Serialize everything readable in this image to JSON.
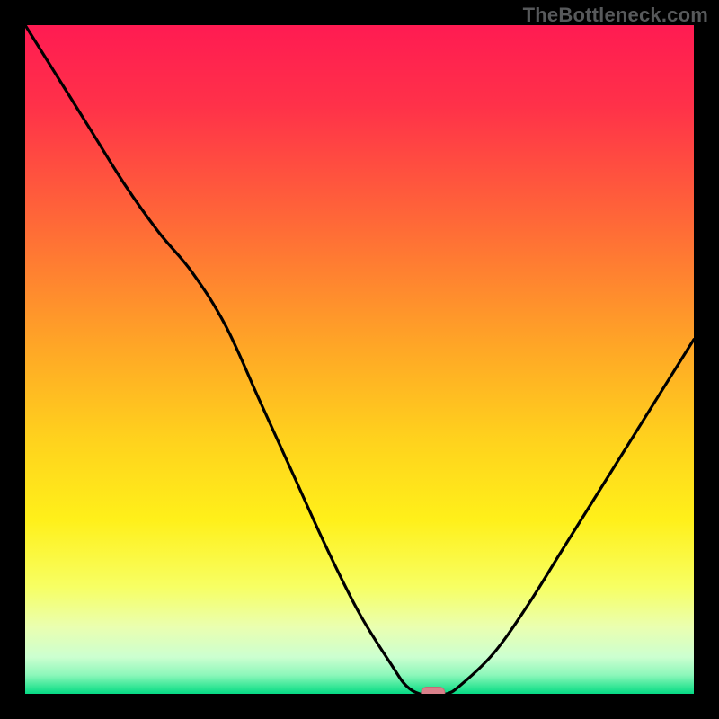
{
  "watermark": "TheBottleneck.com",
  "colors": {
    "frame": "#000000",
    "curve": "#000000",
    "marker_fill": "#d9808a",
    "marker_stroke": "#c46b76",
    "gradient_stops": [
      {
        "offset": 0.0,
        "color": "#ff1b52"
      },
      {
        "offset": 0.12,
        "color": "#ff3149"
      },
      {
        "offset": 0.3,
        "color": "#ff6a37"
      },
      {
        "offset": 0.48,
        "color": "#ffa626"
      },
      {
        "offset": 0.62,
        "color": "#ffd21d"
      },
      {
        "offset": 0.74,
        "color": "#fff01a"
      },
      {
        "offset": 0.84,
        "color": "#f7ff63"
      },
      {
        "offset": 0.9,
        "color": "#eaffb0"
      },
      {
        "offset": 0.945,
        "color": "#ccffd0"
      },
      {
        "offset": 0.972,
        "color": "#8cf7ba"
      },
      {
        "offset": 0.99,
        "color": "#33e695"
      },
      {
        "offset": 1.0,
        "color": "#06d985"
      }
    ]
  },
  "chart_data": {
    "type": "line",
    "title": "",
    "xlabel": "",
    "ylabel": "",
    "xlim": [
      0,
      100
    ],
    "ylim": [
      0,
      100
    ],
    "x": [
      0,
      5,
      10,
      15,
      20,
      25,
      30,
      35,
      40,
      45,
      50,
      55,
      57,
      59,
      61,
      63,
      65,
      70,
      75,
      80,
      85,
      90,
      95,
      100
    ],
    "values": [
      100,
      92,
      84,
      76,
      69,
      63,
      55,
      44,
      33,
      22,
      12,
      4,
      1.2,
      0,
      0,
      0,
      1.2,
      6,
      13,
      21,
      29,
      37,
      45,
      53
    ],
    "marker": {
      "x": 61,
      "y": 0
    },
    "annotations": []
  }
}
